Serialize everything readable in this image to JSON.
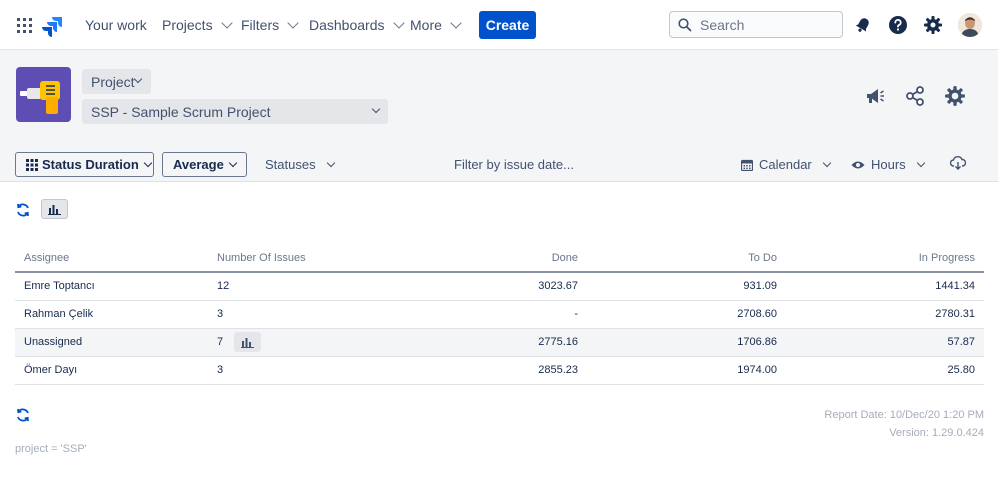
{
  "nav": {
    "items": [
      {
        "label": "Your work",
        "dropdown": false
      },
      {
        "label": "Projects",
        "dropdown": true
      },
      {
        "label": "Filters",
        "dropdown": true
      },
      {
        "label": "Dashboards",
        "dropdown": true
      },
      {
        "label": "More",
        "dropdown": true
      }
    ],
    "create_label": "Create",
    "search_placeholder": "Search",
    "icons": [
      "apps-grid-icon",
      "jira-logo-icon",
      "notifications-icon",
      "help-icon",
      "settings-icon",
      "user-avatar"
    ]
  },
  "project": {
    "type_label": "Project",
    "selected": "SSP - Sample Scrum Project",
    "icons": [
      "announcement-icon",
      "share-icon",
      "settings-icon"
    ]
  },
  "toolbar": {
    "report_type": "Status Duration",
    "aggregation": "Average",
    "statuses_label": "Statuses",
    "date_filter_placeholder": "Filter by issue date...",
    "calendar_label": "Calendar",
    "unit_label": "Hours"
  },
  "table": {
    "headers": [
      "Assignee",
      "Number Of Issues",
      "Done",
      "To Do",
      "In Progress"
    ],
    "rows": [
      {
        "assignee": "Emre Toptancı",
        "issues": "12",
        "done": "3023.67",
        "todo": "931.09",
        "inprogress": "1441.34"
      },
      {
        "assignee": "Rahman Çelik",
        "issues": "3",
        "done": "-",
        "todo": "2708.60",
        "inprogress": "2780.31"
      },
      {
        "assignee": "Unassigned",
        "issues": "7",
        "done": "2775.16",
        "todo": "1706.86",
        "inprogress": "57.87"
      },
      {
        "assignee": "Ömer Dayı",
        "issues": "3",
        "done": "2855.23",
        "todo": "1974.00",
        "inprogress": "25.80"
      }
    ]
  },
  "footer": {
    "report_date": "Report Date: 10/Dec/20 1:20 PM",
    "version": "Version: 1.29.0.424",
    "jql": "project = 'SSP'"
  },
  "colors": {
    "primary": "#0052CC",
    "band_bg": "#F4F5F7",
    "project_avatar": "#5E4DB2",
    "text": "#172B4D",
    "muted": "#6B778C"
  }
}
